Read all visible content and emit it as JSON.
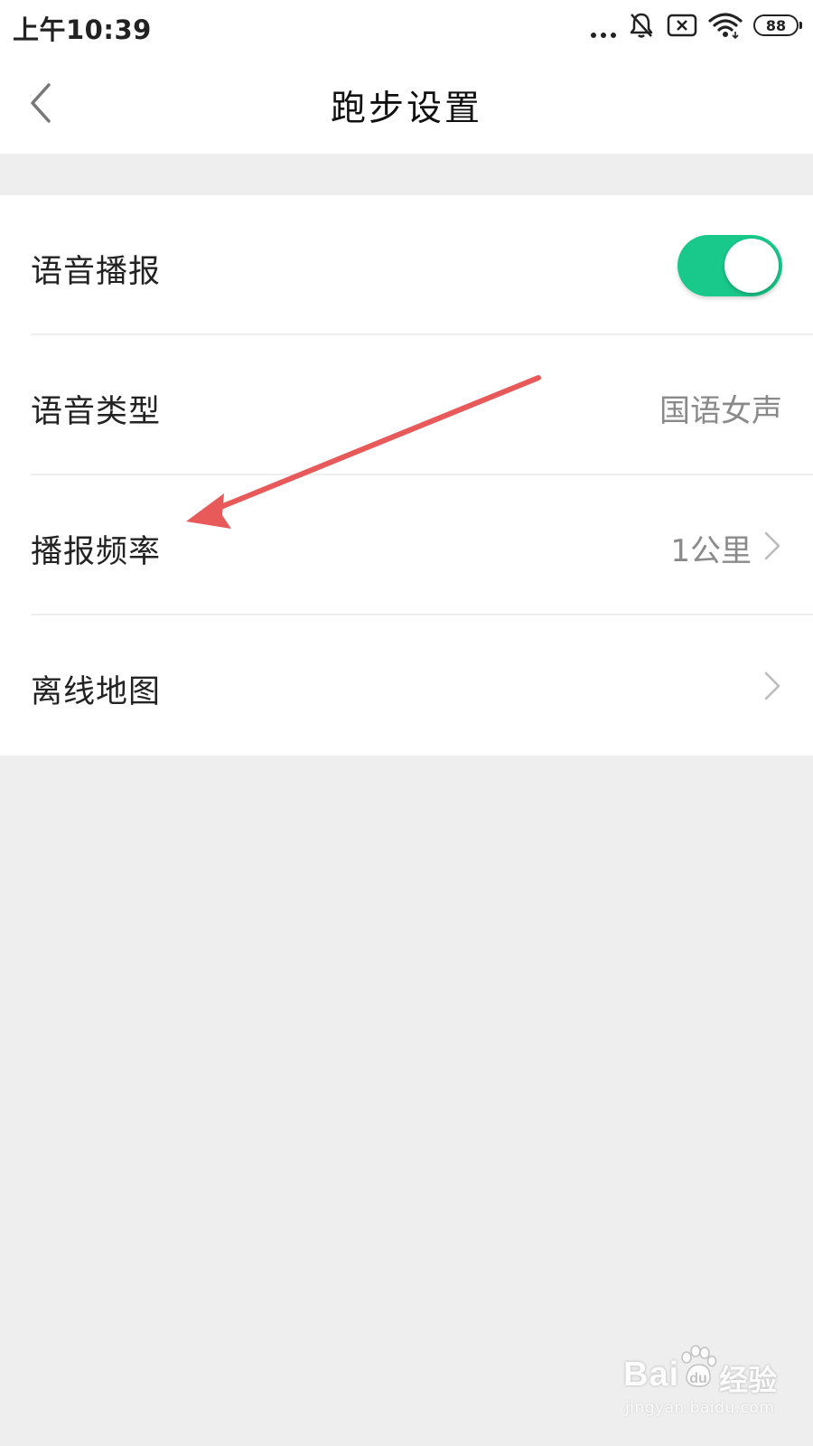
{
  "status_bar": {
    "time": "上午10:39",
    "battery": "88",
    "icons": [
      "more-dots-icon",
      "bell-off-icon",
      "sim-error-icon",
      "wifi-icon",
      "battery-icon"
    ]
  },
  "header": {
    "title": "跑步设置",
    "back_icon": "chevron-left-icon"
  },
  "settings": {
    "voice_broadcast": {
      "label": "语音播报",
      "enabled": true,
      "toggle_color": "#19c98b"
    },
    "voice_type": {
      "label": "语音类型",
      "value": "国语女声"
    },
    "broadcast_frequency": {
      "label": "播报频率",
      "value": "1公里"
    },
    "offline_map": {
      "label": "离线地图"
    }
  },
  "annotation": {
    "arrow_color": "#e85a5a",
    "points_to": "播报频率"
  },
  "watermark": {
    "brand": "Bai",
    "brand_tail": "经验",
    "url": "jingyan.baidu.com"
  },
  "colors": {
    "background": "#eeeeee",
    "surface": "#ffffff",
    "accent": "#19c98b",
    "secondary_text": "#8a8a8a"
  }
}
